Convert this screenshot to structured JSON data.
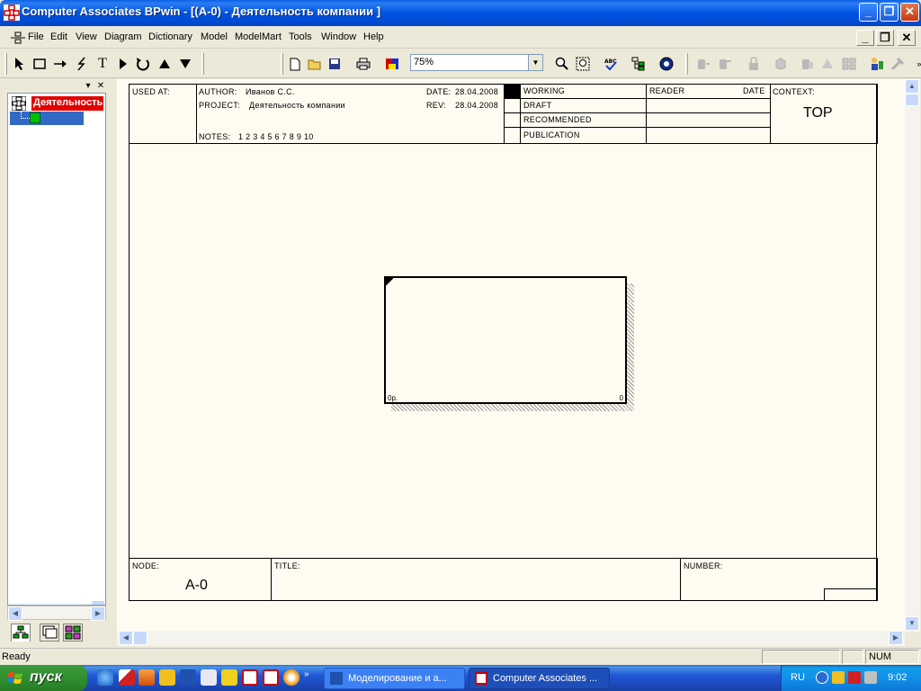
{
  "window": {
    "title": "Computer Associates BPwin - [(A-0)  - Деятельность компании ]",
    "controls": [
      "_",
      "❐",
      "✕"
    ]
  },
  "menu": {
    "items": [
      "File",
      "Edit",
      "View",
      "Diagram",
      "Dictionary",
      "Model",
      "ModelMart",
      "Tools",
      "Window",
      "Help"
    ],
    "mdi_controls": [
      "_",
      "❐",
      "✕"
    ]
  },
  "toolbar": {
    "zoom_value": "75%",
    "tools": [
      "pointer-icon",
      "box-tool-icon",
      "arrow-tool-icon",
      "squiggle-tool-icon",
      "text-tool-icon",
      "off-page-reference-icon",
      "tunnel-icon",
      "parent-diagram-icon",
      "child-diagram-icon",
      "new-icon",
      "open-icon",
      "save-icon",
      "print-icon",
      "color-icon",
      "zoom-icon",
      "zoom-fit-icon",
      "spellcheck-icon",
      "model-explorer-icon",
      "modelmart-icon"
    ]
  },
  "explorer": {
    "root_label": "Деятельность компании",
    "colors": {
      "root_bg": "#e10000",
      "selected_bg": "#316ac5",
      "child_icon": "#00c000"
    }
  },
  "diagram_frame": {
    "used_at_label": "USED AT:",
    "author_label": "AUTHOR:",
    "author_value": "Иванов С.С.",
    "project_label": "PROJECT:",
    "project_value": "Деятельность компании",
    "notes_label": "NOTES:",
    "notes_value": "1  2  3  4  5  6  7  8  9  10",
    "date_label": "DATE:",
    "date_value": "28.04.2008",
    "rev_label": "REV:",
    "rev_value": "28.04.2008",
    "status_rows": [
      "WORKING",
      "DRAFT",
      "RECOMMENDED",
      "PUBLICATION"
    ],
    "reader_label": "READER",
    "reader_date_label": "DATE",
    "context_label": "CONTEXT:",
    "context_value": "TOP",
    "node_label": "NODE:",
    "node_value": "A-0",
    "title_label": "TITLE:",
    "number_label": "NUMBER:"
  },
  "activity": {
    "cost": "0р.",
    "number": "0"
  },
  "statusbar": {
    "text": "Ready",
    "num": "NUM"
  },
  "taskbar": {
    "start_label": "пуск",
    "tasks": [
      {
        "label": "Моделирование и а...",
        "active": false
      },
      {
        "label": "Computer Associates ...",
        "active": true
      }
    ],
    "lang": "RU",
    "time": "9:02"
  }
}
